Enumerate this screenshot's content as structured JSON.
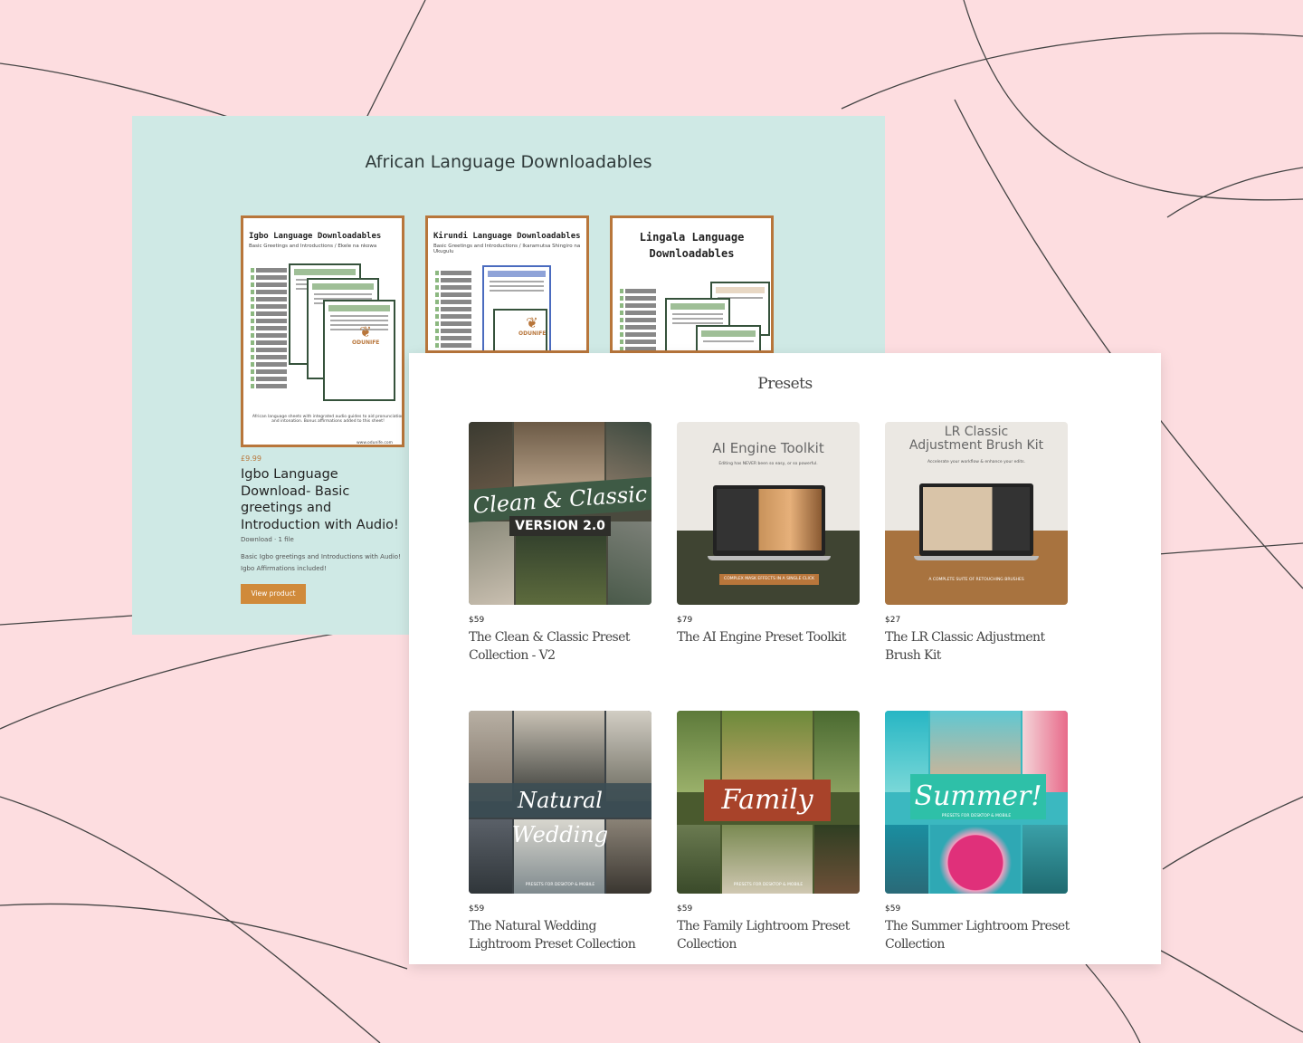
{
  "colors": {
    "background": "#fddde0",
    "mint_panel": "#cfe9e5",
    "accent_orange": "#d08a3a",
    "card_border": "#b8763b"
  },
  "african_store": {
    "title": "African Language Downloadables",
    "cards": [
      {
        "title": "Igbo Language Downloadables",
        "subtitle": "Basic Greetings and Introductions / Ekele na nkowa",
        "footer": "African language sheets with integrated audio guides to aid pronunciation and intonation. Bonus affirmations added to this sheet!",
        "url": "www.odunife.com",
        "logo": "ODUNIFE"
      },
      {
        "title": "Kirundi Language Downloadables",
        "subtitle": "Basic Greetings and Introductions / Ikaramutsa Shingiro na Ukugulu",
        "logo": "ODUNIFE"
      },
      {
        "title": "Lingala Language Downloadables"
      }
    ],
    "featured": {
      "price": "£9.99",
      "name": "Igbo Language Download- Basic greetings and Introduction with Audio!",
      "meta": "Download · 1 file",
      "description": "Basic Igbo greetings and Introductions with Audio! Igbo Affirmations included!",
      "button_label": "View product"
    }
  },
  "presets_store": {
    "title": "Presets",
    "items": [
      {
        "price": "$59",
        "name": "The Clean & Classic Preset Collection - V2",
        "thumb_text": "Clean & Classic",
        "thumb_sub": "VERSION 2.0"
      },
      {
        "price": "$79",
        "name": "The AI Engine Preset Toolkit",
        "thumb_text": "AI Engine Toolkit",
        "thumb_sub": "Editing has NEVER been so easy, or so powerful.",
        "thumb_cta": "COMPLEX MASK EFFECTS IN A SINGLE CLICK"
      },
      {
        "price": "$27",
        "name": "The LR Classic Adjustment Brush Kit",
        "thumb_text": "LR Classic Adjustment Brush Kit",
        "thumb_sub": "Accelerate your workflow & enhance your edits.",
        "thumb_cta": "A COMPLETE SUITE OF RETOUCHING BRUSHES"
      },
      {
        "price": "$59",
        "name": "The Natural Wedding Lightroom Preset Collection",
        "thumb_text": "Natural Wedding",
        "thumb_sub": "PRESETS FOR DESKTOP & MOBILE"
      },
      {
        "price": "$59",
        "name": "The Family Lightroom Preset Collection",
        "thumb_text": "Family",
        "thumb_sub": "PRESETS FOR DESKTOP & MOBILE"
      },
      {
        "price": "$59",
        "name": "The Summer Lightroom Preset Collection",
        "thumb_text": "Summer!",
        "thumb_sub": "PRESETS FOR DESKTOP & MOBILE"
      }
    ]
  }
}
